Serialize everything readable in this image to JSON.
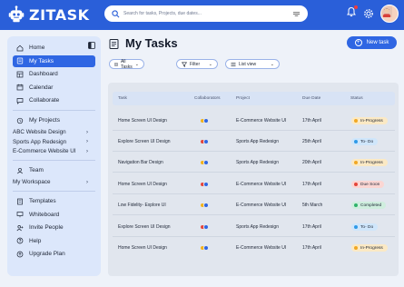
{
  "app": {
    "name": "ZITASK"
  },
  "search": {
    "placeholder": "Search for tasks, Projects, due dates..."
  },
  "sidebar": {
    "main_items": [
      {
        "label": "Home",
        "icon": "home-icon"
      },
      {
        "label": "My Tasks",
        "icon": "tasks-icon",
        "active": true
      },
      {
        "label": "Dashboard",
        "icon": "dashboard-icon"
      },
      {
        "label": "Calendar",
        "icon": "calendar-icon"
      },
      {
        "label": "Collaborate",
        "icon": "chat-icon"
      }
    ],
    "projects_label": "My Projects",
    "projects": [
      "ABC Website Design",
      "Sports App Redesign",
      "E-Commerce Website UI"
    ],
    "team_label": "Team",
    "workspace_label": "My Workspace",
    "bottom_items": [
      {
        "label": "Templates",
        "icon": "templates-icon"
      },
      {
        "label": "Whiteboard",
        "icon": "whiteboard-icon"
      },
      {
        "label": "Invite People",
        "icon": "invite-icon"
      },
      {
        "label": "Help",
        "icon": "help-icon"
      },
      {
        "label": "Upgrade Plan",
        "icon": "upgrade-icon"
      }
    ]
  },
  "main": {
    "title": "My Tasks",
    "new_task_label": "New task",
    "filters": {
      "all_tasks": "All Tasks",
      "filter": "Filter",
      "list_view": "List view"
    }
  },
  "table": {
    "columns": [
      "Task",
      "Collaborators",
      "Project",
      "Due Date",
      "Status"
    ],
    "rows": [
      {
        "task": "Home Screen UI Design",
        "project": "E-Commerce Website UI",
        "due": "17th April",
        "status": "In-Progress",
        "status_key": "progress"
      },
      {
        "task": "Explore Screen UI Design",
        "project": "Sports App Redesign",
        "due": "25th April",
        "status": "To- Do",
        "status_key": "todo"
      },
      {
        "task": "Navigation Bar Design",
        "project": "Sports App Redesign",
        "due": "20th April",
        "status": "In-Progress",
        "status_key": "progress"
      },
      {
        "task": "Home Screen UI Design",
        "project": "E-Commerce Website UI",
        "due": "17th April",
        "status": "Due Soon",
        "status_key": "due"
      },
      {
        "task": "Low Fidelity- Explore UI",
        "project": "E-Commerce Website UI",
        "due": "5th March",
        "status": "Completed",
        "status_key": "done"
      },
      {
        "task": "Explore Screen UI Design",
        "project": "Sports App Redesign",
        "due": "17th April",
        "status": "To- Do",
        "status_key": "todo"
      },
      {
        "task": "Home Screen UI Design",
        "project": "E-Commerce Website UI",
        "due": "17th April",
        "status": "In-Progress",
        "status_key": "progress"
      }
    ]
  },
  "colors": {
    "accent": "#2f66e3",
    "topbar": "#2a5fd9",
    "status": {
      "progress": {
        "bg": "#fbe9c4",
        "dot": "#f1a824"
      },
      "todo": {
        "bg": "#cfe6fb",
        "dot": "#2f9ae8"
      },
      "due": {
        "bg": "#fbd6d3",
        "dot": "#e5453a"
      },
      "done": {
        "bg": "#cfeede",
        "dot": "#2fb36b"
      }
    },
    "collaborators": [
      "#f3b21b",
      "#2f66e3",
      "#e5453a",
      "#2fb36b"
    ]
  }
}
